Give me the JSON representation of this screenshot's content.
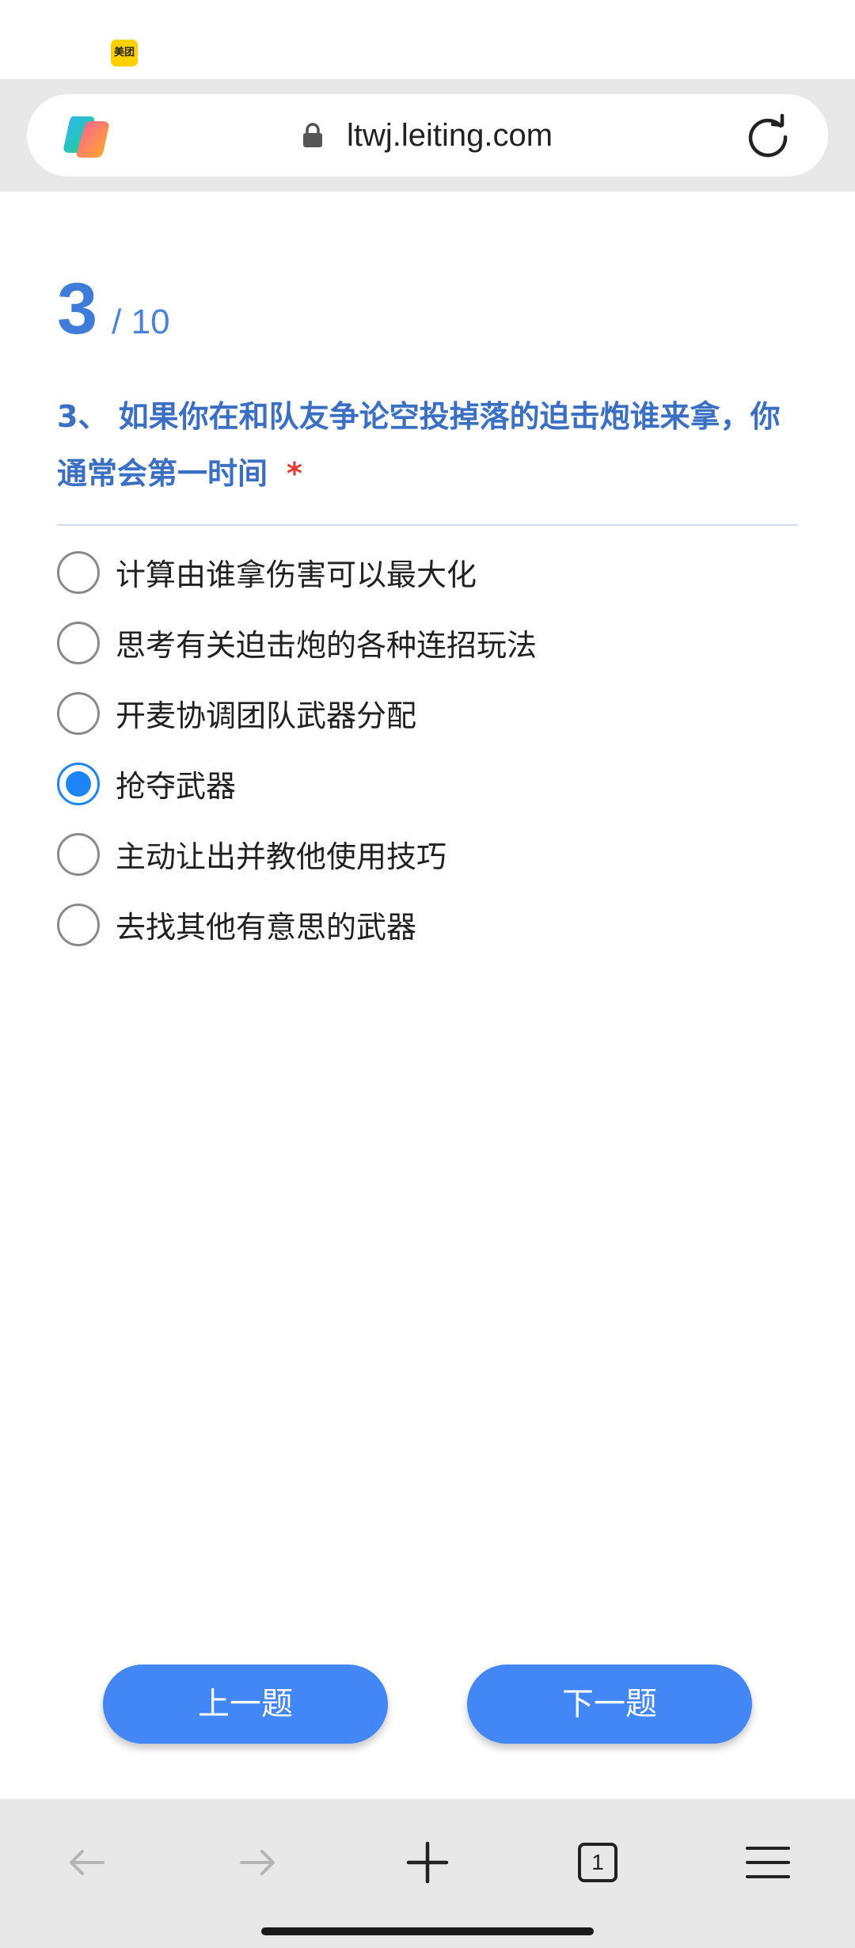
{
  "status_bar": {
    "app_badge": "美团"
  },
  "browser": {
    "url": "ltwj.leiting.com",
    "tab_count": "1"
  },
  "survey": {
    "progress_current": "3",
    "progress_total": "/ 10",
    "question_text": "3、 如果你在和队友争论空投掉落的迫击炮谁来拿，你通常会第一时间",
    "required_mark": "*",
    "options": [
      {
        "label": "计算由谁拿伤害可以最大化",
        "selected": false
      },
      {
        "label": "思考有关迫击炮的各种连招玩法",
        "selected": false
      },
      {
        "label": "开麦协调团队武器分配",
        "selected": false
      },
      {
        "label": "抢夺武器",
        "selected": true
      },
      {
        "label": "主动让出并教他使用技巧",
        "selected": false
      },
      {
        "label": "去找其他有意思的武器",
        "selected": false
      }
    ],
    "prev_button": "上一题",
    "next_button": "下一题"
  },
  "colors": {
    "accent": "#3a6fc4",
    "radio_selected": "#1e84f5",
    "button": "#4287f5",
    "required": "#e53935"
  }
}
